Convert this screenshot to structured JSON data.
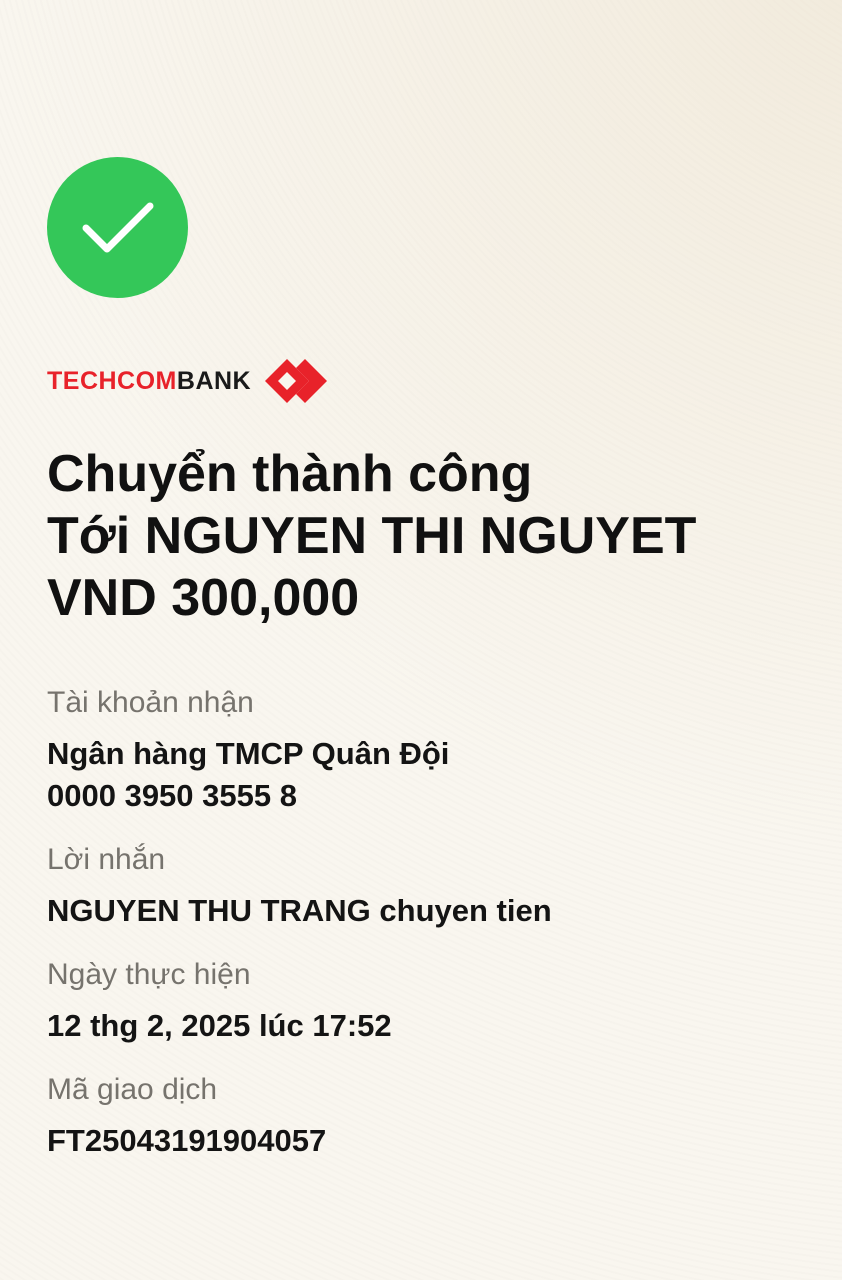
{
  "logo": {
    "red_text": "TECHCOM",
    "dark_text": "BANK",
    "mark_icon": "techcombank-diamond-logo",
    "brand_red": "#e8222a"
  },
  "status": {
    "icon": "success-check-icon",
    "color": "#34c759"
  },
  "headline": {
    "line1": "Chuyển thành công",
    "line2": "Tới NGUYEN THI NGUYET",
    "line3": "VND 300,000"
  },
  "details": {
    "receiving_account": {
      "label": "Tài khoản nhận",
      "bank": "Ngân hàng TMCP Quân Đội",
      "number": "0000 3950 3555 8"
    },
    "message": {
      "label": "Lời nhắn",
      "value": "NGUYEN THU TRANG chuyen tien"
    },
    "date": {
      "label": "Ngày thực hiện",
      "value": "12 thg 2, 2025 lúc 17:52"
    },
    "transaction_id": {
      "label": "Mã giao dịch",
      "value": "FT25043191904057"
    }
  }
}
